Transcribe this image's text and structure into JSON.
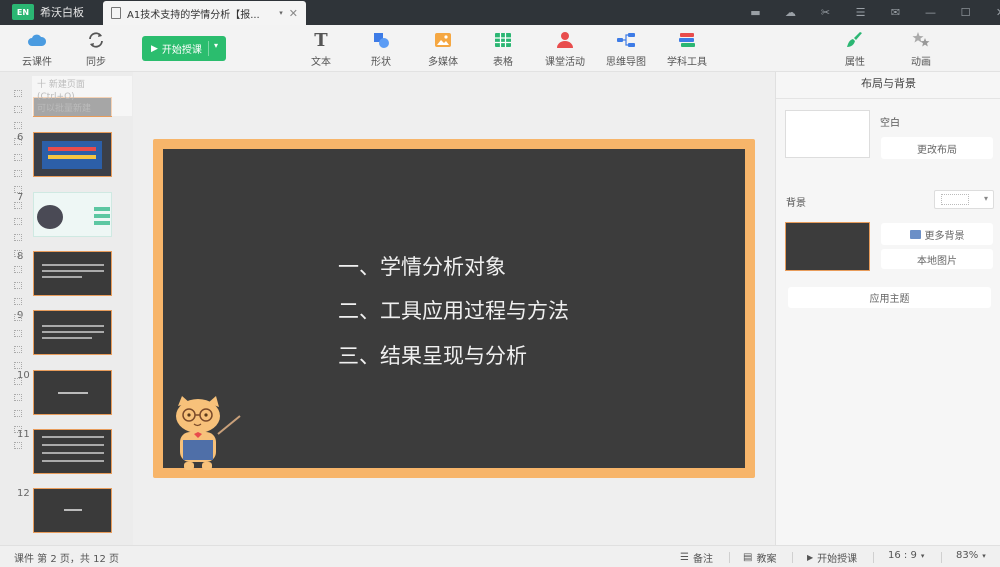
{
  "app": {
    "name": "希沃白板",
    "logo_text": "EN"
  },
  "document_tab": {
    "title": "A1技术支持的学情分析【报..."
  },
  "toolbar": {
    "cloud_label": "云课件",
    "sync_label": "同步",
    "start_label": "开始授课",
    "tools": [
      {
        "id": "text",
        "label": "文本"
      },
      {
        "id": "shape",
        "label": "形状"
      },
      {
        "id": "media",
        "label": "多媒体"
      },
      {
        "id": "table",
        "label": "表格"
      },
      {
        "id": "activity",
        "label": "课堂活动"
      },
      {
        "id": "mindmap",
        "label": "思维导图"
      },
      {
        "id": "subject",
        "label": "学科工具"
      }
    ],
    "properties_label": "属性",
    "animation_label": "动画"
  },
  "thumbnail_tip": {
    "line1": "十 新建页面",
    "line2": "(Ctrl+O)",
    "line3": "可以批量新建"
  },
  "thumbnails": [
    {
      "num": "6"
    },
    {
      "num": "7"
    },
    {
      "num": "8"
    },
    {
      "num": "9"
    },
    {
      "num": "10"
    },
    {
      "num": "11"
    },
    {
      "num": "12"
    }
  ],
  "slide": {
    "lines": [
      "一、学情分析对象",
      "二、工具应用过程与方法",
      "三、结果呈现与分析"
    ]
  },
  "panel": {
    "title": "布局与背景",
    "blank_label": "空白",
    "change_layout": "更改布局",
    "background_label": "背景",
    "more_backgrounds": "更多背景",
    "local_image": "本地图片",
    "apply_theme": "应用主题"
  },
  "status": {
    "page_info": "课件 第 2 页，共 12 页",
    "notes": "备注",
    "lesson_plan": "教案",
    "start": "开始授课",
    "ratio": "16 : 9",
    "zoom": "83%"
  },
  "colors": {
    "accent": "#2bbd6e",
    "board_frame": "#f7b56a",
    "board": "#3c3c3c"
  }
}
